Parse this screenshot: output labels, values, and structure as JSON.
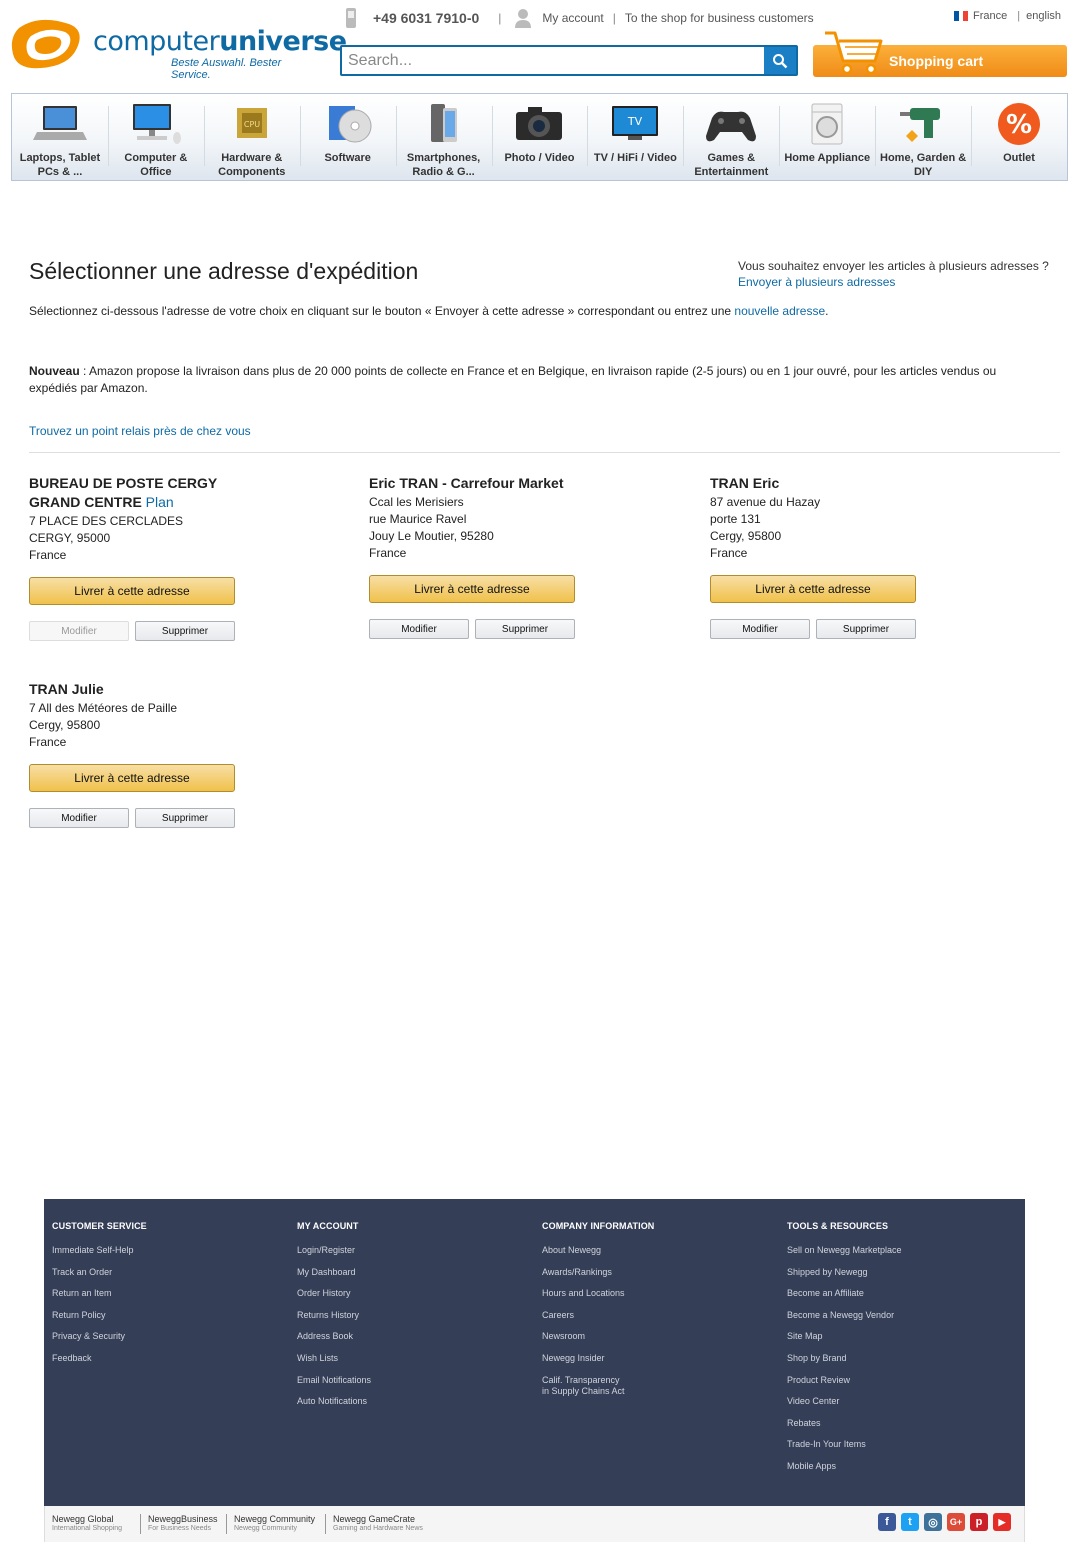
{
  "header": {
    "logo_text_light": "computer",
    "logo_text_bold": "universe",
    "slogan": "Beste Auswahl. Bester Service.",
    "phone": "+49 6031 7910-0",
    "separator": "|",
    "my_account": "My account",
    "business_link": "To the shop for business customers",
    "lang_france": "France",
    "lang_english": "english",
    "search_placeholder": "Search...",
    "cart_label": "Shopping cart"
  },
  "categories": [
    {
      "label": "Laptops, Tablet PCs & ...",
      "icon": "laptop-icon"
    },
    {
      "label": "Computer & Office",
      "icon": "computer-icon"
    },
    {
      "label": "Hardware & Components",
      "icon": "cpu-icon"
    },
    {
      "label": "Software",
      "icon": "software-icon"
    },
    {
      "label": "Smartphones, Radio & G...",
      "icon": "smartphone-icon"
    },
    {
      "label": "Photo / Video",
      "icon": "camera-icon"
    },
    {
      "label": "TV / HiFi / Video",
      "icon": "tv-icon"
    },
    {
      "label": "Games & Entertainment",
      "icon": "gamepad-icon"
    },
    {
      "label": "Home Appliance",
      "icon": "washing-machine-icon"
    },
    {
      "label": "Home, Garden & DIY",
      "icon": "drill-icon"
    },
    {
      "label": "Outlet",
      "icon": "percent-icon"
    }
  ],
  "main": {
    "title": "Sélectionner une adresse d'expédition",
    "multi_question": "Vous souhaitez envoyer les articles à plusieurs adresses ?",
    "multi_link": "Envoyer à plusieurs adresses",
    "intro_text": "Sélectionnez ci-dessous l'adresse de votre choix en cliquant sur le bouton « Envoyer à cette adresse » correspondant ou  entrez une ",
    "intro_link": "nouvelle adresse",
    "intro_end": ".",
    "notice_bold": "Nouveau",
    "notice_text": " : Amazon propose la livraison dans plus de 20 000 points de collecte en France et en Belgique, en livraison rapide (2-5 jours) ou en 1 jour ouvré, pour les articles vendus ou expédiés par Amazon.",
    "relais_link": "Trouvez un point relais près de chez vous",
    "deliver_label": "Livrer à cette adresse",
    "modify_label": "Modifier",
    "delete_label": "Supprimer"
  },
  "addresses": [
    {
      "name": "BUREAU DE POSTE CERGY GRAND CENTRE",
      "name_link": "Plan",
      "line1": "7 PLACE DES CERCLADES",
      "line2": "",
      "city": "CERGY, 95000",
      "country": "France",
      "modify_disabled": true
    },
    {
      "name": "Eric TRAN - Carrefour Market",
      "line1": "Ccal les Merisiers",
      "line2": "rue Maurice Ravel",
      "city": "Jouy Le Moutier, 95280",
      "country": "France",
      "modify_disabled": false
    },
    {
      "name": "TRAN Eric",
      "line1": "87 avenue du Hazay",
      "line2": "porte 131",
      "city": "Cergy, 95800",
      "country": "France",
      "modify_disabled": false
    },
    {
      "name": "TRAN Julie",
      "line1": "7 All des Météores de Paille",
      "line2": "",
      "city": "Cergy, 95800",
      "country": "France",
      "modify_disabled": false
    }
  ],
  "footer": {
    "columns": [
      {
        "heading": "CUSTOMER SERVICE",
        "items": [
          "Immediate Self-Help",
          "Track an Order",
          "Return an Item",
          "Return Policy",
          "Privacy & Security",
          "Feedback"
        ]
      },
      {
        "heading": "MY ACCOUNT",
        "items": [
          "Login/Register",
          "My Dashboard",
          "Order History",
          "Returns History",
          "Address Book",
          "Wish Lists",
          "Email Notifications",
          "Auto Notifications"
        ]
      },
      {
        "heading": "COMPANY INFORMATION",
        "items": [
          "About Newegg",
          "Awards/Rankings",
          "Hours and Locations",
          "Careers",
          "Newsroom",
          "Newegg Insider",
          "Calif. Transparency\nin Supply Chains Act"
        ]
      },
      {
        "heading": "TOOLS & RESOURCES",
        "items": [
          "Sell on Newegg Marketplace",
          "Shipped by Newegg",
          "Become an Affiliate",
          "Become a Newegg Vendor",
          "Site Map",
          "Shop by Brand",
          "Product Review",
          "Video Center",
          "Rebates",
          "Trade-In Your Items",
          "Mobile Apps"
        ]
      }
    ],
    "bottom_links": [
      {
        "title": "Newegg Global",
        "sub": "International Shopping"
      },
      {
        "title": "NeweggBusiness",
        "sub": "For Business Needs"
      },
      {
        "title": "Newegg Community",
        "sub": "Newegg Community"
      },
      {
        "title": "Newegg GameCrate",
        "sub": "Gaming and Hardware News"
      }
    ],
    "social": [
      {
        "icon": "facebook-icon",
        "glyph": "f",
        "color": "#3b5998"
      },
      {
        "icon": "twitter-icon",
        "glyph": "t",
        "color": "#1da1f2"
      },
      {
        "icon": "instagram-icon",
        "glyph": "◎",
        "color": "#3f729b"
      },
      {
        "icon": "google-plus-icon",
        "glyph": "G+",
        "color": "#dd4b39"
      },
      {
        "icon": "pinterest-icon",
        "glyph": "p",
        "color": "#cb2027"
      },
      {
        "icon": "youtube-icon",
        "glyph": "▶",
        "color": "#e52d27"
      }
    ]
  },
  "colors": {
    "brand_blue": "#0f6aa4",
    "brand_orange": "#f39200",
    "footer_bg": "#343e56",
    "deliver_button": "#f0c14b"
  }
}
